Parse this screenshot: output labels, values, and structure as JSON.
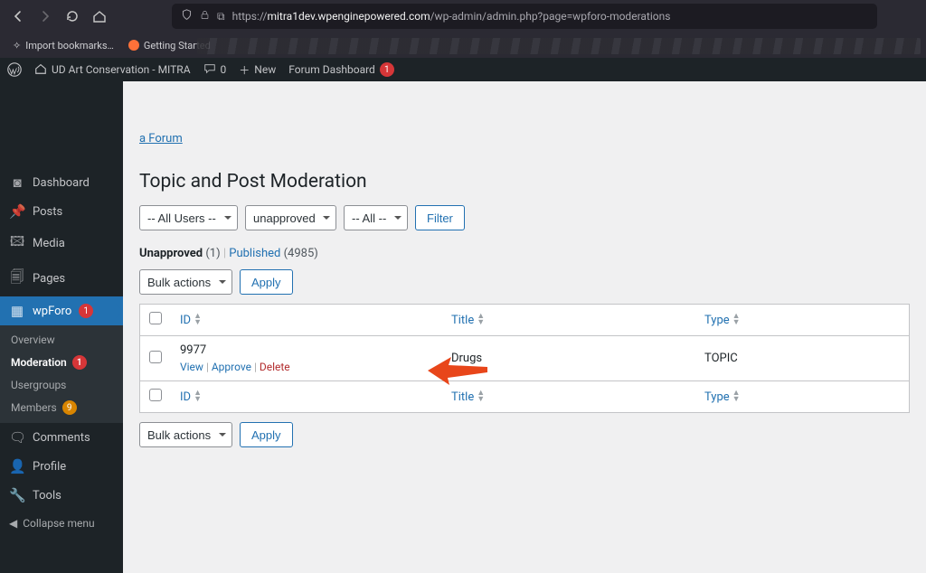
{
  "browser": {
    "url_prefix_icons": {
      "shield": "shield",
      "lock": "lock"
    },
    "url_protocol": "https://",
    "url_domain": "mitra1dev.wpenginepowered.com",
    "url_path": "/wp-admin/admin.php?page=wpforo-moderations",
    "bookmarks": {
      "import": "Import bookmarks…",
      "getting_started": "Getting Started"
    }
  },
  "admin_bar": {
    "site_title": "UD Art Conservation - MITRA",
    "comments_count": "0",
    "new_label": "New",
    "forum_dashboard": "Forum Dashboard",
    "forum_dashboard_badge": "1"
  },
  "sidebar": {
    "items": {
      "dashboard": {
        "label": "Dashboard"
      },
      "posts": {
        "label": "Posts"
      },
      "media": {
        "label": "Media"
      },
      "pages": {
        "label": "Pages"
      },
      "wpforo": {
        "label": "wpForo",
        "badge": "1"
      },
      "comments": {
        "label": "Comments"
      },
      "profile": {
        "label": "Profile"
      },
      "tools": {
        "label": "Tools"
      }
    },
    "wpforo_submenu": {
      "overview": "Overview",
      "moderation": "Moderation",
      "moderation_badge": "1",
      "usergroups": "Usergroups",
      "members": "Members",
      "members_badge": "9"
    },
    "collapse": "Collapse menu"
  },
  "content": {
    "forum_link": "a Forum",
    "page_title": "Topic and Post Moderation",
    "filters": {
      "users": "-- All Users --",
      "status": "unapproved",
      "all": "-- All --",
      "filter_btn": "Filter"
    },
    "views": {
      "unapproved_label": "Unapproved",
      "unapproved_count": "(1)",
      "published_label": "Published",
      "published_count": "(4985)"
    },
    "bulk": {
      "select": "Bulk actions",
      "apply": "Apply"
    },
    "columns": {
      "id": "ID",
      "title": "Title",
      "type": "Type"
    },
    "row": {
      "id": "9977",
      "title": "Drugs",
      "type": "TOPIC",
      "actions": {
        "view": "View",
        "approve": "Approve",
        "delete": "Delete"
      }
    }
  }
}
